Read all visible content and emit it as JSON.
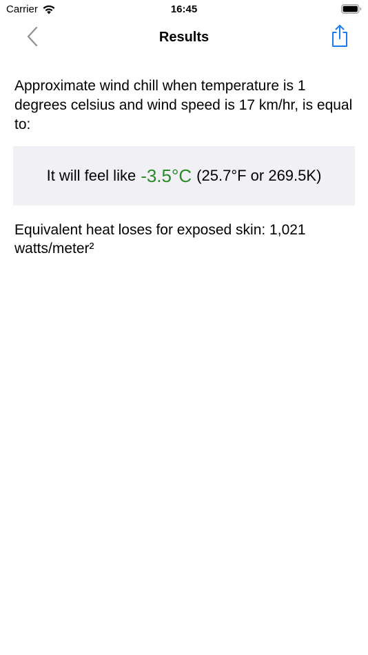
{
  "status_bar": {
    "carrier": "Carrier",
    "time": "16:45",
    "wifi_icon": "wifi-icon",
    "battery_icon": "battery-icon"
  },
  "nav": {
    "title": "Results",
    "back_icon": "chevron-left-icon",
    "share_icon": "share-icon",
    "accent_color": "#1a7cf0"
  },
  "content": {
    "description": "Approximate wind chill when temperature is 1 degrees celsius and wind speed is 17 km/hr, is equal to:",
    "result_prefix": "It will feel like",
    "result_value": "-3.5°C",
    "result_alt": "(25.7°F or 269.5K)",
    "result_color": "#2a8a2a",
    "heat_loss": "Equivalent heat loses for exposed skin: 1,021 watts/meter²"
  }
}
